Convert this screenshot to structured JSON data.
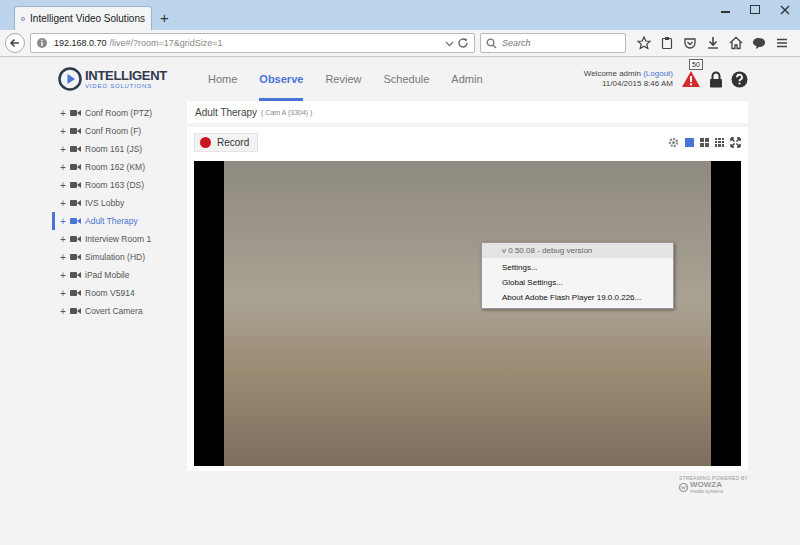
{
  "browser": {
    "tab": {
      "title": "Intelligent Video Solutions"
    },
    "new_tab": "+",
    "address": {
      "host": "192.168.0.70",
      "path": "/live#/?room=17&gridSize=1"
    },
    "search": {
      "placeholder": "Search"
    }
  },
  "app": {
    "logo": {
      "name": "INTELLIGENT",
      "tagline": "VIDEO SOLUTIONS"
    },
    "nav": [
      {
        "label": "Home",
        "selected": false
      },
      {
        "label": "Observe",
        "selected": true
      },
      {
        "label": "Review",
        "selected": false
      },
      {
        "label": "Schedule",
        "selected": false
      },
      {
        "label": "Admin",
        "selected": false
      }
    ],
    "user": {
      "welcome": "Welcome admin",
      "logout": "(Logout)",
      "datetime": "11/04/2015 8:46 AM"
    },
    "alerts": {
      "count": "50"
    }
  },
  "sidebar": {
    "items": [
      {
        "toggle": "+",
        "label": "Conf Room (PTZ)",
        "selected": false
      },
      {
        "toggle": "+",
        "label": "Conf Room (F)",
        "selected": false
      },
      {
        "toggle": "+",
        "label": "Room 161 (JS)",
        "selected": false
      },
      {
        "toggle": "+",
        "label": "Room 162 (KM)",
        "selected": false
      },
      {
        "toggle": "+",
        "label": "Room 163 (DS)",
        "selected": false
      },
      {
        "toggle": "+",
        "label": "IVS Lobby",
        "selected": false
      },
      {
        "toggle": "+",
        "label": "Adult Therapy",
        "selected": true
      },
      {
        "toggle": "+",
        "label": "Interview Room 1",
        "selected": false
      },
      {
        "toggle": "+",
        "label": "Simulation (HD)",
        "selected": false
      },
      {
        "toggle": "+",
        "label": "iPad Mobile",
        "selected": false
      },
      {
        "toggle": "+",
        "label": "Room V5914",
        "selected": false
      },
      {
        "toggle": "+",
        "label": "Covert Camera",
        "selected": false
      }
    ]
  },
  "panel": {
    "title": "Adult Therapy",
    "subtitle": "( Cam A (3304) )",
    "record": "Record",
    "layouts": [
      {
        "kind": "single",
        "selected": true
      },
      {
        "kind": "quad",
        "selected": false
      },
      {
        "kind": "nine",
        "selected": false
      }
    ]
  },
  "context_menu": {
    "header": "v 0.50.08 - debug version",
    "items": [
      "Settings...",
      "Global Settings...",
      "About Adobe Flash Player 19.0.0.226..."
    ]
  },
  "footer": {
    "line": "STREAMING POWERED BY",
    "brand": "WOWZA",
    "tagline": "media systems"
  }
}
